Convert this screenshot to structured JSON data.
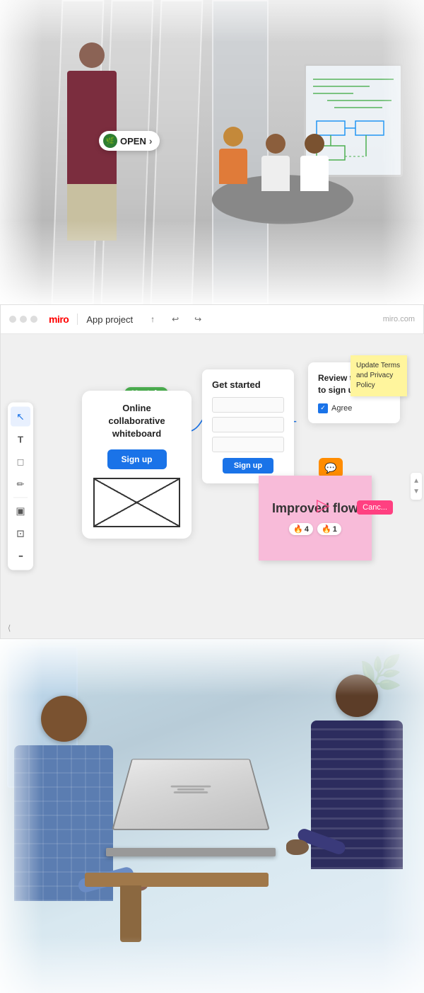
{
  "topPhoto": {
    "alt": "Office meeting room scene",
    "openBadge": {
      "icon": "🌿",
      "label": "OPEN",
      "arrow": ">"
    }
  },
  "miro": {
    "windowDots": [
      "dot1",
      "dot2",
      "dot3"
    ],
    "logo": "miro",
    "separator": "|",
    "projectName": "App project",
    "toolbarIcons": {
      "export": "↑",
      "undo": "↩",
      "redo": "↪"
    },
    "urlText": "miro.com",
    "tools": [
      {
        "name": "cursor",
        "icon": "↖",
        "active": true
      },
      {
        "name": "text",
        "icon": "T"
      },
      {
        "name": "rectangle",
        "icon": "□"
      },
      {
        "name": "pen",
        "icon": "✏"
      },
      {
        "name": "sticky",
        "icon": "▣"
      },
      {
        "name": "frame",
        "icon": "⊡"
      },
      {
        "name": "more",
        "icon": "•••"
      }
    ],
    "canvas": {
      "mustafaBadge": "Mustafa",
      "wireframeCard": {
        "title": "Online collaborative whiteboard",
        "signupLabel": "Sign up"
      },
      "getStartedCard": {
        "title": "Get started",
        "signupLabel": "Sign up"
      },
      "reviewCard": {
        "title": "Review the Terms to sign up",
        "agreeLabel": "Agree"
      },
      "stickyYellow": {
        "text": "Update Terms and Privacy Policy"
      },
      "stickyPink": {
        "text": "Improved flow",
        "reactions": [
          {
            "emoji": "🔥",
            "count": "4"
          },
          {
            "emoji": "🔥",
            "count": "1"
          }
        ]
      },
      "commentBubble": "💬",
      "cancelBadge": "Canc...",
      "pageNumber": "⟨"
    }
  },
  "bottomPhoto": {
    "alt": "Two people reviewing work on laptop"
  }
}
